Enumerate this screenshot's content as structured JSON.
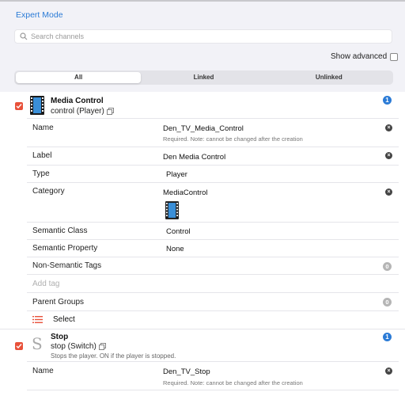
{
  "header": {
    "expert_mode": "Expert Mode",
    "search_placeholder": "Search channels",
    "show_advanced": "Show advanced"
  },
  "tabs": [
    {
      "label": "All",
      "active": true
    },
    {
      "label": "Linked",
      "active": false
    },
    {
      "label": "Unlinked",
      "active": false
    }
  ],
  "channels": [
    {
      "title": "Media Control",
      "subtitle": "control (Player)",
      "badge": "1",
      "fields": {
        "name_label": "Name",
        "name_value": "Den_TV_Media_Control",
        "name_note": "Required. Note: cannot be changed after the creation",
        "label_label": "Label",
        "label_value": "Den Media Control",
        "type_label": "Type",
        "type_value": "Player",
        "category_label": "Category",
        "category_value": "MediaControl",
        "semantic_class_label": "Semantic Class",
        "semantic_class_value": "Control",
        "semantic_property_label": "Semantic Property",
        "semantic_property_value": "None",
        "non_semantic_tags_label": "Non-Semantic Tags",
        "non_semantic_tags_count": "0",
        "add_tag_placeholder": "Add tag",
        "parent_groups_label": "Parent Groups",
        "parent_groups_count": "0",
        "select_label": "Select"
      }
    },
    {
      "title": "Stop",
      "subtitle": "stop (Switch)",
      "description": "Stops the player. ON if the player is stopped.",
      "badge": "1",
      "fields": {
        "name_label": "Name",
        "name_value": "Den_TV_Stop",
        "name_note": "Required. Note: cannot be changed after the creation"
      }
    }
  ],
  "colors": {
    "accent": "#2b7bd6",
    "checkbox": "#e8513a"
  }
}
